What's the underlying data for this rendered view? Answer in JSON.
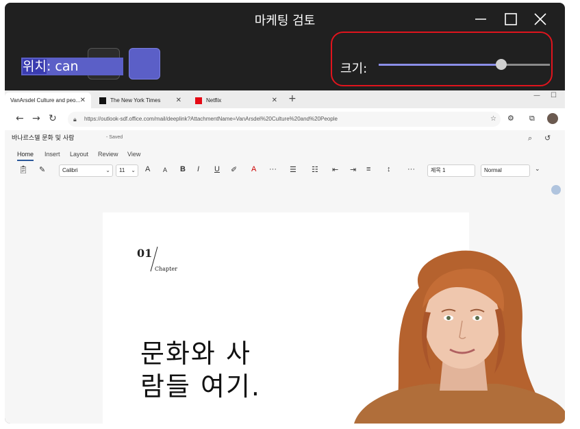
{
  "window": {
    "title": "마케팅 검토",
    "controls": {
      "minimize": "—",
      "maximize": "☐",
      "close": "✕"
    }
  },
  "position": {
    "label_key": "위치",
    "label_rest": ": can",
    "selected_layout": 2
  },
  "size": {
    "label": "크기:",
    "value_fraction": 0.72
  },
  "browser": {
    "tabs": [
      {
        "label": "VanArsdel Culture and peo...",
        "active": true
      },
      {
        "label": "The New York Times",
        "active": false
      },
      {
        "label": "Netflix",
        "active": false
      }
    ],
    "new_tab": "+",
    "url": "https://outlook-sdf.office.com/mail/deeplink?AttachmentName=VanArsdel%20Culture%20and%20People"
  },
  "document": {
    "title": "바나르스델 문화 및 사람",
    "status": "- Saved"
  },
  "ribbon": {
    "tabs": [
      "Home",
      "Insert",
      "Layout",
      "Review",
      "View"
    ],
    "active_tab": "Home",
    "font_name": "Calibri",
    "font_size": "11",
    "heading_style": "제목 1",
    "paragraph_style": "Normal",
    "bold": "B",
    "italic": "I",
    "underline": "U",
    "more": "···"
  },
  "page": {
    "chapter_number": "01",
    "chapter_word": "Chapter",
    "heading_line1": "문화와 사",
    "heading_line2": "람들 여기."
  },
  "colors": {
    "accent": "#5b5fc7",
    "highlight_border": "#e1141d",
    "window_bg": "#202020"
  }
}
